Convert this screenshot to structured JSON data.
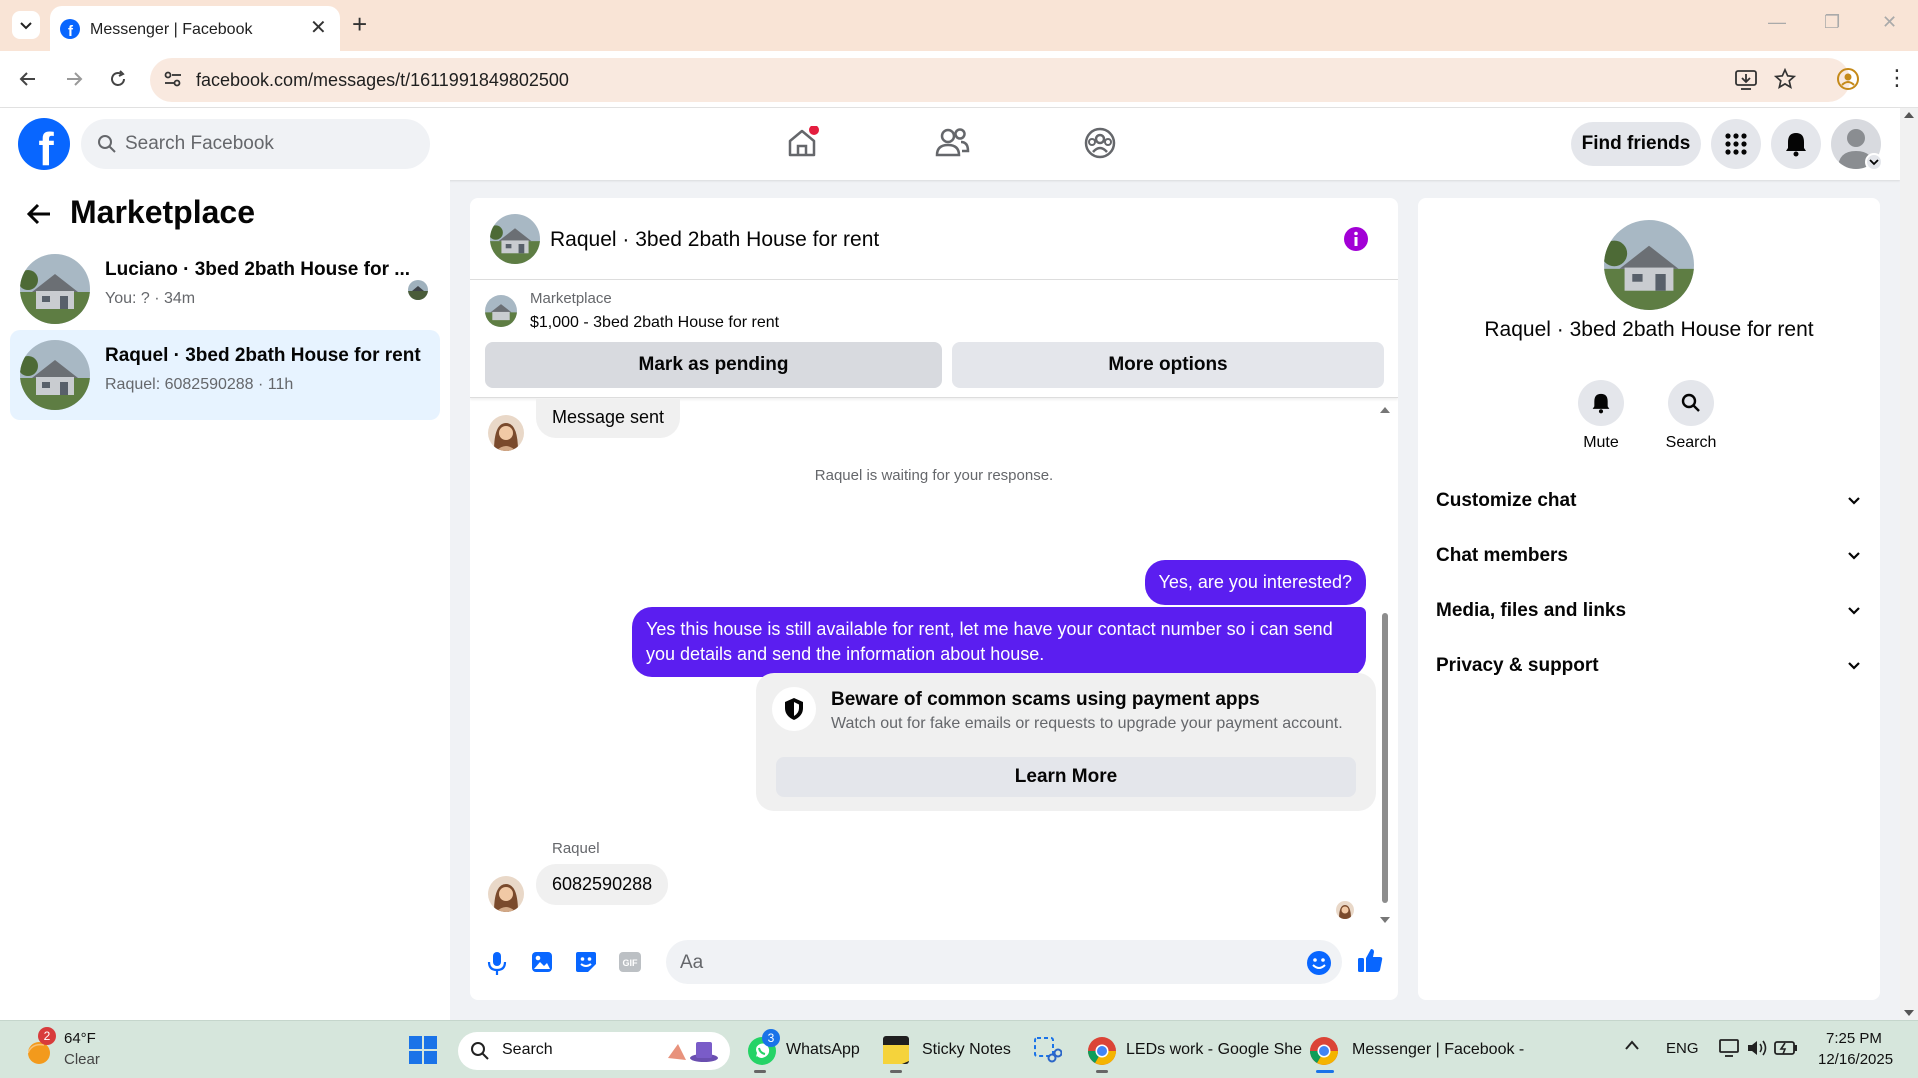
{
  "browser": {
    "tab_title": "Messenger | Facebook",
    "url": "facebook.com/messages/t/1611991849802500"
  },
  "fb_header": {
    "search_placeholder": "Search Facebook",
    "find_friends": "Find friends",
    "brand_color": "#0866ff"
  },
  "left_panel": {
    "title": "Marketplace",
    "conversations": [
      {
        "title": "Luciano · 3bed 2bath House for ...",
        "snippet": "You: ? · 34m",
        "selected": false
      },
      {
        "title": "Raquel · 3bed 2bath House for rent",
        "snippet": "Raquel: 6082590288 · 11h",
        "selected": true
      }
    ]
  },
  "chat": {
    "header_title": "Raquel · 3bed 2bath House for rent",
    "listing": {
      "source": "Marketplace",
      "title": "$1,000 - 3bed 2bath House for rent",
      "mark_pending": "Mark as pending",
      "more_options": "More options"
    },
    "messages": {
      "first_incoming": "Message sent",
      "waiting_notice": "Raquel is waiting for your response.",
      "outgoing_1": "Yes, are you interested?",
      "outgoing_2": "Yes this house is still available for rent, let me have your contact number so i can send you details and send the information about house.",
      "scam_title": "Beware of common scams using payment apps",
      "scam_desc": "Watch out for fake emails or requests to upgrade your payment account.",
      "learn_more": "Learn More",
      "sender_name": "Raquel",
      "last_incoming": "6082590288"
    },
    "composer_placeholder": "Aa",
    "accent_color": "#5b1ef0"
  },
  "right_panel": {
    "title": "Raquel · 3bed 2bath House for rent",
    "mute": "Mute",
    "search": "Search",
    "sections": [
      "Customize chat",
      "Chat members",
      "Media, files and links",
      "Privacy & support"
    ]
  },
  "taskbar": {
    "weather_temp": "64°F",
    "weather_desc": "Clear",
    "weather_badge": "2",
    "search": "Search",
    "apps": {
      "whatsapp": "WhatsApp",
      "whatsapp_badge": "3",
      "sticky": "Sticky Notes",
      "chrome1": "LEDs work - Google She",
      "chrome2": "Messenger | Facebook -"
    },
    "lang": "ENG",
    "time": "7:25 PM",
    "date": "12/16/2025"
  }
}
